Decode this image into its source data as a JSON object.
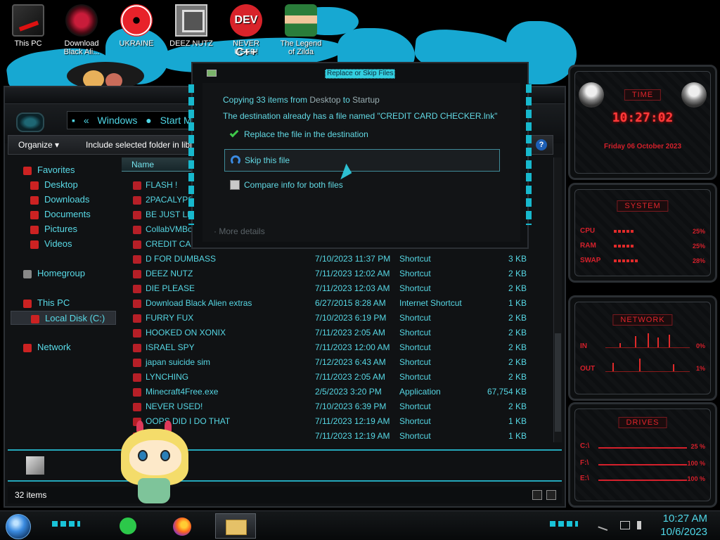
{
  "desktop": {
    "icons": [
      {
        "label": "This PC"
      },
      {
        "label": "Download Black Ali..."
      },
      {
        "label": "UKRAINE"
      },
      {
        "label": "DEEZ NUTZ"
      },
      {
        "label": "NEVER USED!"
      },
      {
        "label": "The Legend of Zilda"
      }
    ],
    "dev_icon_text": "DEV C++"
  },
  "explorer": {
    "address": {
      "chevron": "«",
      "segment1": "Windows",
      "segment2": "Start M"
    },
    "toolbar": {
      "organize_label": "Organize ▾",
      "include_label": "Include selected folder in libra",
      "help_label": "?"
    },
    "nav": {
      "favorites": "Favorites",
      "desktop": "Desktop",
      "downloads": "Downloads",
      "documents": "Documents",
      "pictures": "Pictures",
      "videos": "Videos",
      "homegroup": "Homegroup",
      "this_pc": "This PC",
      "local_disk": "Local Disk (C:)",
      "network": "Network"
    },
    "column_name": "Name",
    "files_partial": [
      {
        "name": "FLASH !"
      },
      {
        "name": "2PACALYPSE"
      },
      {
        "name": "BE JUST LIKE"
      },
      {
        "name": "CollabVMBot"
      },
      {
        "name": "CREDIT CARD"
      }
    ],
    "files": [
      {
        "name": "D FOR DUMBASS",
        "date": "7/10/2023 11:37 PM",
        "type": "Shortcut",
        "size": "3 KB"
      },
      {
        "name": "DEEZ NUTZ",
        "date": "7/11/2023 12:02 AM",
        "type": "Shortcut",
        "size": "2 KB"
      },
      {
        "name": "DIE PLEASE",
        "date": "7/11/2023 12:03 AM",
        "type": "Shortcut",
        "size": "2 KB"
      },
      {
        "name": "Download Black Alien extras",
        "date": "6/27/2015 8:28 AM",
        "type": "Internet Shortcut",
        "size": "1 KB"
      },
      {
        "name": "FURRY FUX",
        "date": "7/10/2023 6:19 PM",
        "type": "Shortcut",
        "size": "2 KB"
      },
      {
        "name": "HOOKED ON XONIX",
        "date": "7/11/2023 2:05 AM",
        "type": "Shortcut",
        "size": "2 KB"
      },
      {
        "name": "ISRAEL SPY",
        "date": "7/11/2023 12:00 AM",
        "type": "Shortcut",
        "size": "2 KB"
      },
      {
        "name": "japan suicide sim",
        "date": "7/12/2023 6:43 AM",
        "type": "Shortcut",
        "size": "2 KB"
      },
      {
        "name": "LYNCHING",
        "date": "7/11/2023 2:05 AM",
        "type": "Shortcut",
        "size": "2 KB"
      },
      {
        "name": "Minecraft4Free.exe",
        "date": "2/5/2023 3:20 PM",
        "type": "Application",
        "size": "67,754 KB"
      },
      {
        "name": "NEVER USED!",
        "date": "7/10/2023 6:39 PM",
        "type": "Shortcut",
        "size": "2 KB"
      },
      {
        "name": "OOPS DID I DO THAT",
        "date": "7/11/2023 12:19 AM",
        "type": "Shortcut",
        "size": "1 KB"
      },
      {
        "name": "",
        "date": "7/11/2023 12:19 AM",
        "type": "Shortcut",
        "size": "1 KB"
      }
    ],
    "status": {
      "count": "32 items"
    }
  },
  "dialog": {
    "title": "Replace or Skip Files",
    "copying_prefix": "Copying 33 items from ",
    "source": "Desktop",
    "to_word": " to ",
    "destination": "Startup",
    "conflict": "The destination already has a file named \"CREDIT CARD CHECKER.lnk\"",
    "option_replace": "Replace the file in the destination",
    "option_skip": "Skip this file",
    "option_compare": "Compare info for both files",
    "more_details": "More details"
  },
  "gadgets": {
    "time": {
      "title": "TIME",
      "clock": "10:27:02",
      "date": "Friday 06 October 2023"
    },
    "system": {
      "title": "SYSTEM",
      "cpu_label": "CPU",
      "cpu_value": "25%",
      "cpu_level": 0.25,
      "ram_label": "RAM",
      "ram_value": "25%",
      "ram_level": 0.25,
      "swap_label": "SWAP",
      "swap_value": "28%",
      "swap_level": 0.28
    },
    "network": {
      "title": "NETWORK",
      "in_label": "IN",
      "in_value": "0%",
      "out_label": "OUT",
      "out_value": "1%"
    },
    "drives": {
      "title": "DRIVES",
      "d1_label": "C:\\",
      "d1_value": "25 %",
      "d2_label": "F:\\",
      "d2_value": "100 %",
      "d3_label": "E:\\",
      "d3_value": "100 %"
    }
  },
  "taskbar": {
    "apps": [
      {
        "name": "spotify-icon"
      },
      {
        "name": "firefox-icon"
      },
      {
        "name": "file-explorer-icon"
      }
    ],
    "clock_time": "10:27 AM",
    "clock_date": "10/6/2023"
  }
}
